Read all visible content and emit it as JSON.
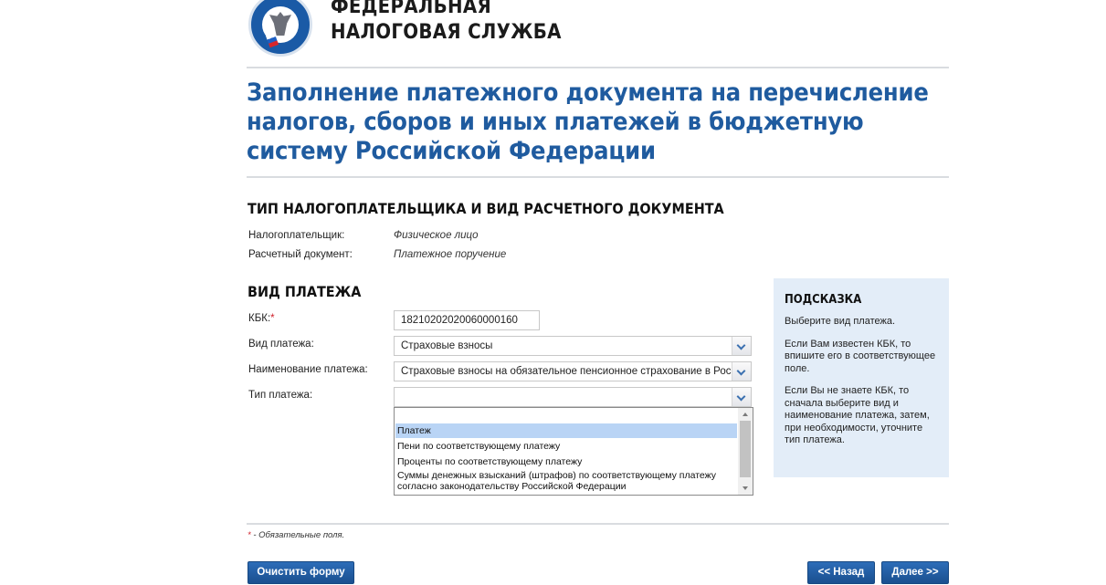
{
  "header": {
    "org_line1": "ФЕДЕРАЛЬНАЯ",
    "org_line2": "НАЛОГОВАЯ СЛУЖБА",
    "logo_text": "ФЕДЕРАЛЬНАЯ НАЛОГОВАЯ СЛУЖБА"
  },
  "page_title": "Заполнение платежного документа на перечисление налогов, сборов и иных платежей в бюджетную систему Российской Федерации",
  "section_doc": {
    "heading": "ТИП НАЛОГОПЛАТЕЛЬЩИКА И ВИД РАСЧЕТНОГО ДОКУМЕНТА",
    "taxpayer_label": "Налогоплательщик:",
    "taxpayer_value": "Физическое лицо",
    "doc_label": "Расчетный документ:",
    "doc_value": "Платежное поручение"
  },
  "section_payment": {
    "heading": "ВИД ПЛАТЕЖА",
    "kbk_label": "КБК:",
    "kbk_required": "*",
    "kbk_value": "18210202020060000160",
    "type_label": "Вид платежа:",
    "type_value": "Страховые взносы",
    "name_label": "Наименование платежа:",
    "name_value": "Страховые взносы на обязательное пенсионное страхование в Росс",
    "kind_label": "Тип платежа:",
    "kind_value": "",
    "kind_options": [
      "Платеж",
      "Пени по соответствующему платежу",
      "Проценты по соответствующему платежу",
      "Суммы денежных взысканий (штрафов) по соответствующему платежу согласно законодательству Российской Федерации"
    ],
    "kind_highlighted": 0
  },
  "hint": {
    "title": "ПОДСКАЗКА",
    "p1": "Выберите вид платежа.",
    "p2": "Если Вам известен КБК, то впишите его в соответствующее поле.",
    "p3": "Если Вы не знаете КБК, то сначала выберите вид и наименование платежа, затем, при необходимости, уточните тип платежа."
  },
  "footer": {
    "req_mark": "*",
    "req_note": " - Обязательные поля.",
    "clear_button": "Очистить форму",
    "back_button": "<< Назад",
    "next_button": "Далее >>"
  }
}
